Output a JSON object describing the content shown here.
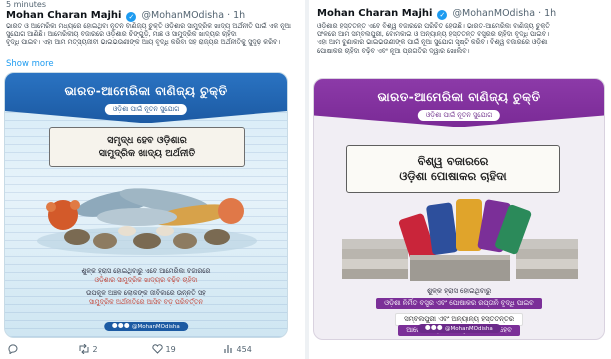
{
  "left_post": {
    "top_cut": "5 minutes",
    "author": "Mohan Charan Majhi",
    "handle": "@MohanMOdisha",
    "time": "· 1h",
    "text_lines": [
      "ଭାରତ ଓ ଆମେରିକା ମଧ୍ୟରେ ହୋଇଥିବା ନୂତନ ବାଣିଜ୍ୟ ଚୁକ୍ତି ଓଡ଼ିଶାର ସାମୁଦ୍ରିକ ଖାଦ୍ୟ ଅର୍ଥନୀତି ପାଇଁ ଏକ ନୂଆ",
      "ସୁଯୋଗ ଆଣିଛି। ଆମେରିକୀୟ ବଜାରରେ ଓଡ଼ିଶାର ଚିଙ୍ଗୁଡ଼ି, ମାଛ ଓ ସାମୁଦ୍ରିକ ଖାଦ୍ୟର ଚାହିଦା",
      "ବୃଦ୍ଧି ପାଇବ। ଏହା ଆମ ମତ୍ସ୍ୟଜୀବୀ ଭାଇଭଉଣୀଙ୍କ ଆୟ ବୃଦ୍ଧି କରିବା ସହ ରାଜ୍ୟର ଅର୍ଥନୀତିକୁ ସୁଦୃଢ଼ କରିବ।"
    ],
    "show_more": "Show more",
    "card": {
      "title": "ଭାରତ-ଆମେରିକା ବାଣିଜ୍ୟ ଚୁକ୍ତି",
      "subtitle": "ଓଡ଼ିଶା ପାଇଁ ନୂତନ ସୁଯୋଗ",
      "headline_1": "ସମୃଦ୍ଧ ହେବ ଓଡ଼ିଶାର",
      "headline_2": "ସାମୁଦ୍ରିକ ଖାଦ୍ୟ ଅର୍ଥନୀତି",
      "caption_1a": "ଶୁଳ୍କ ହ୍ରାସ ହୋଇଥିବାରୁ ଏବେ ଆମେରିକା ବଜାରରେ",
      "caption_1b": "ଓଡ଼ିଶାର ସାମୁଦ୍ରିକ ଖାଦ୍ୟର ବଢ଼ିବ ଚାହିଦା",
      "caption_2a": "ଉପକୂଳ ଅଞ୍ଚଳ ଲୋକଙ୍କ ଜୀବିକାରେ ଉନ୍ନତି ସହ",
      "caption_2b": "ସାମୁଦ୍ରିକ ଅର୍ଥନୀତିରେ ଆସିବ ବଡ଼ ପରିବର୍ତ୍ତନ",
      "footer": "@MohanMOdisha"
    },
    "actions": {
      "replies": "",
      "reposts": "2",
      "likes": "19",
      "views": "454"
    }
  },
  "right_post": {
    "author": "Mohan Charan Majhi",
    "handle": "@MohanMOdisha",
    "time": "· 1h",
    "text_lines": [
      "ଓଡ଼ିଶାର ହସ୍ତତନ୍ତ ଏବେ ବିଶ୍ୱ ବଜାରରେ ପରିଚିତ ହେଉଛି। ଭାରତ-ଆମେରିକା ବାଣିଜ୍ୟ ଚୁକ୍ତି",
      "ଫଳରେ ଆମ ସମ୍ବଲପୁରୀ, ବୋମକାଇ ଓ ଅନ୍ୟାନ୍ୟ ହସ୍ତତନ୍ତ ବସ୍ତ୍ରର ଚାହିଦା ବୃଦ୍ଧି ପାଇବ।",
      "ଏହା ଆମ ବୁଣାକାର ଭାଇଭଉଣୀଙ୍କ ପାଇଁ ନୂଆ ସୁଯୋଗ ସୃଷ୍ଟି କରିବ। ବିଶ୍ୱ ବଜାରରେ ଓଡ଼ିଶା",
      "ପୋଷାକର ଚାହିଦା ବଢ଼ିବ ଏବଂ ନୂଆ ପ୍ରଗତିର ଦ୍ୱାର ଖୋଲିବ।"
    ],
    "card": {
      "title": "ଭାରତ-ଆମେରିକା ବାଣିଜ୍ୟ ଚୁକ୍ତି",
      "subtitle": "ଓଡ଼ିଶା ପାଇଁ ନୂତନ ସୁଯୋଗ",
      "headline_1": "ବିଶ୍ୱ ବଜାରରେ",
      "headline_2": "ଓଡ଼ିଶା ପୋଷାକର ଚାହିଦା",
      "caption_1": "ଶୁଳ୍କ ହ୍ରାସ ହୋଇଥିବାରୁ",
      "caption_2": "ଓଡ଼ିଶା ନିର୍ମିତ ବସ୍ତ୍ର ଏବଂ ପୋଷାକର ରପ୍ତାନି ବୃଦ୍ଧି ପାଇବ",
      "caption_3": "ସମ୍ବଲପୁରୀ ଏବଂ ଅନ୍ୟାନ୍ୟ ହସ୍ତତନ୍ତର",
      "caption_4": "ଆମେରିକୀୟ ବଜାର ପ୍ରବେଶ ସହଜ ହେବ",
      "footer": "@MohanMOdisha"
    }
  },
  "colors": {
    "link": "#1d9bf0",
    "blue_banner": "#1c5aa3",
    "purple_banner": "#7a2a96",
    "muted": "#536471"
  },
  "icons": [
    "verified-badge-icon",
    "reply-icon",
    "repost-icon",
    "like-icon",
    "views-icon",
    "footer-social-icon"
  ]
}
